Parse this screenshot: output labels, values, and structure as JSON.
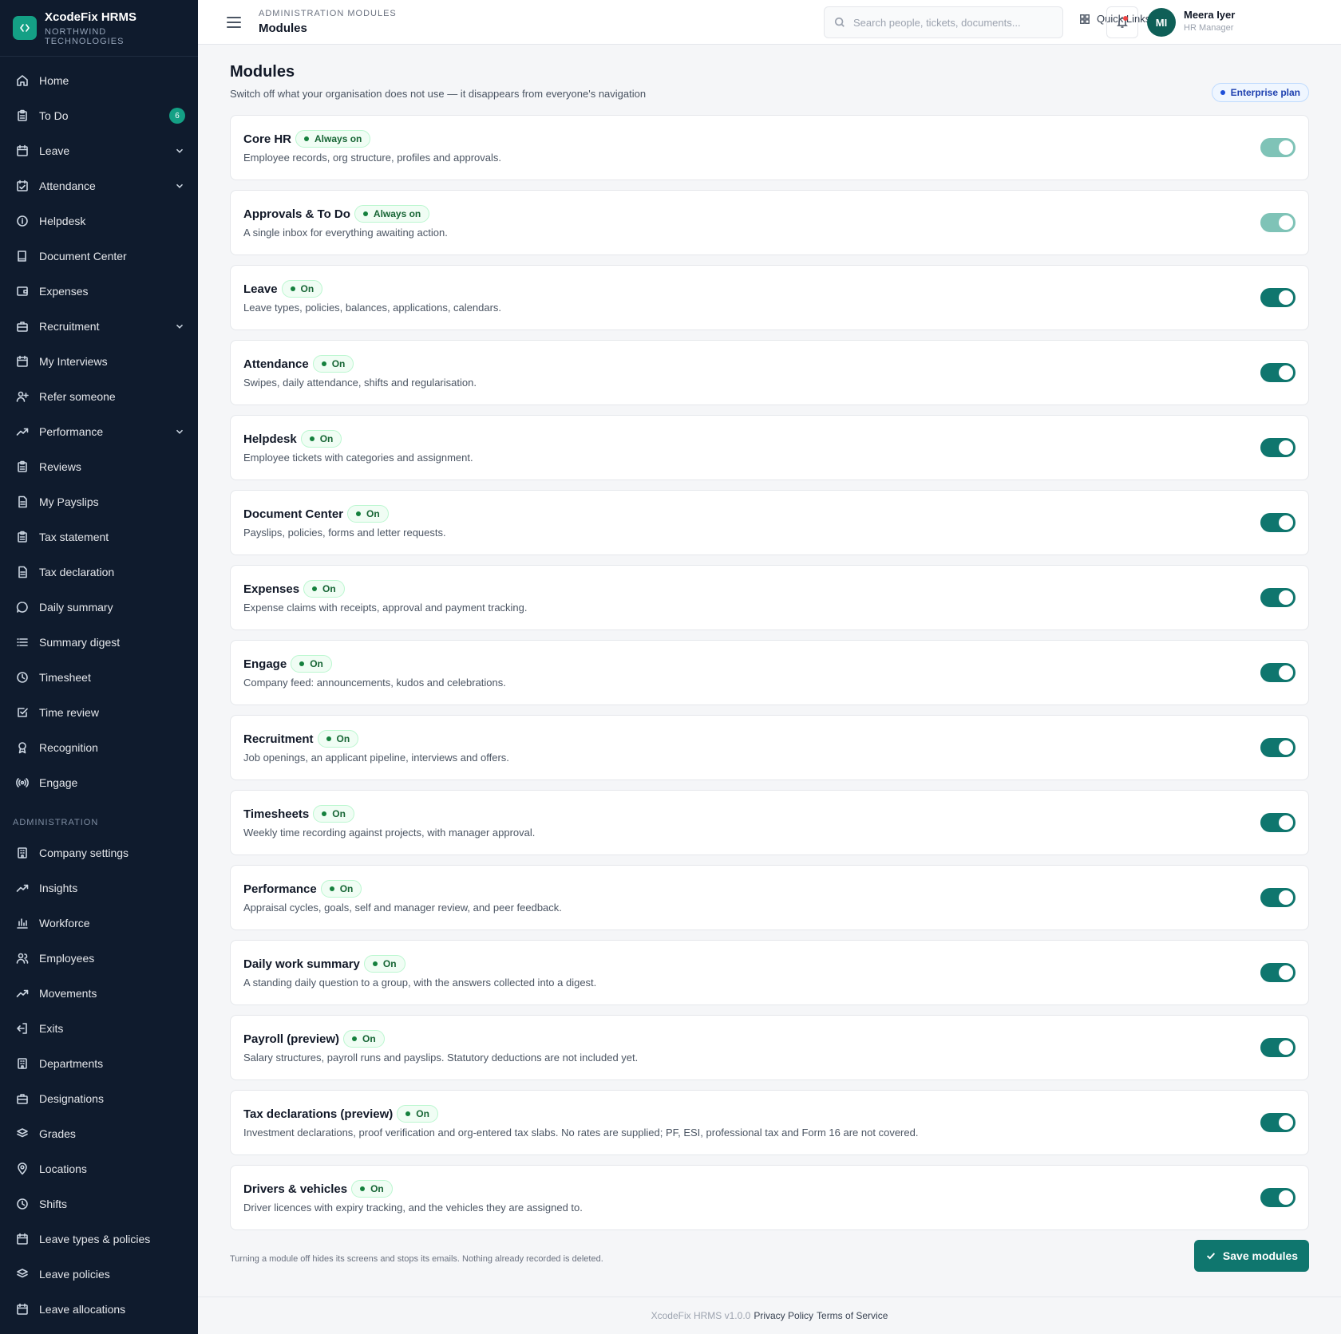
{
  "brand": {
    "name": "XcodeFix HRMS",
    "org": "NORTHWIND TECHNOLOGIES"
  },
  "sidebar": {
    "items": [
      {
        "label": "Home",
        "icon": "home-icon"
      },
      {
        "label": "To Do",
        "icon": "clipboard-icon",
        "badge": "6"
      },
      {
        "label": "Leave",
        "icon": "calendar-icon",
        "chevron": true
      },
      {
        "label": "Attendance",
        "icon": "calendar-check-icon",
        "chevron": true
      },
      {
        "label": "Helpdesk",
        "icon": "info-icon"
      },
      {
        "label": "Document Center",
        "icon": "book-icon"
      },
      {
        "label": "Expenses",
        "icon": "wallet-icon"
      },
      {
        "label": "Recruitment",
        "icon": "briefcase-icon",
        "chevron": true
      },
      {
        "label": "My Interviews",
        "icon": "calendar-icon"
      },
      {
        "label": "Refer someone",
        "icon": "user-plus-icon"
      },
      {
        "label": "Performance",
        "icon": "trend-icon",
        "chevron": true
      },
      {
        "label": "Reviews",
        "icon": "clipboard-icon"
      },
      {
        "label": "My Payslips",
        "icon": "file-icon"
      },
      {
        "label": "Tax statement",
        "icon": "clipboard-icon"
      },
      {
        "label": "Tax declaration",
        "icon": "file-icon"
      },
      {
        "label": "Daily summary",
        "icon": "chat-icon"
      },
      {
        "label": "Summary digest",
        "icon": "list-icon"
      },
      {
        "label": "Timesheet",
        "icon": "clock-icon"
      },
      {
        "label": "Time review",
        "icon": "check-square-icon"
      },
      {
        "label": "Recognition",
        "icon": "award-icon"
      },
      {
        "label": "Engage",
        "icon": "broadcast-icon"
      }
    ],
    "admin_section": "ADMINISTRATION",
    "admin_items": [
      {
        "label": "Company settings",
        "icon": "building-icon"
      },
      {
        "label": "Insights",
        "icon": "trend-icon"
      },
      {
        "label": "Workforce",
        "icon": "bar-chart-icon"
      },
      {
        "label": "Employees",
        "icon": "users-icon"
      },
      {
        "label": "Movements",
        "icon": "trend-icon"
      },
      {
        "label": "Exits",
        "icon": "logout-icon"
      },
      {
        "label": "Departments",
        "icon": "building-icon"
      },
      {
        "label": "Designations",
        "icon": "briefcase-icon"
      },
      {
        "label": "Grades",
        "icon": "layers-icon"
      },
      {
        "label": "Locations",
        "icon": "pin-icon"
      },
      {
        "label": "Shifts",
        "icon": "clock-icon"
      },
      {
        "label": "Leave types & policies",
        "icon": "calendar-icon"
      },
      {
        "label": "Leave policies",
        "icon": "layers-icon"
      },
      {
        "label": "Leave allocations",
        "icon": "calendar-icon"
      }
    ]
  },
  "header": {
    "crumb": "ADMINISTRATION MODULES",
    "title": "Modules",
    "search_placeholder": "Search people, tickets, documents...",
    "quick_links": "Quick Links",
    "user": {
      "initials": "MI",
      "name": "Meera Iyer",
      "role": "HR Manager"
    }
  },
  "page": {
    "title": "Modules",
    "subtitle": "Switch off what your organisation does not use — it disappears from everyone's navigation",
    "plan": "Enterprise plan"
  },
  "modules": [
    {
      "name": "Core HR",
      "status": "Always on",
      "locked": true,
      "enabled": true,
      "description": "Employee records, org structure, profiles and approvals."
    },
    {
      "name": "Approvals & To Do",
      "status": "Always on",
      "locked": true,
      "enabled": true,
      "description": "A single inbox for everything awaiting action."
    },
    {
      "name": "Leave",
      "status": "On",
      "locked": false,
      "enabled": true,
      "description": "Leave types, policies, balances, applications, calendars."
    },
    {
      "name": "Attendance",
      "status": "On",
      "locked": false,
      "enabled": true,
      "description": "Swipes, daily attendance, shifts and regularisation."
    },
    {
      "name": "Helpdesk",
      "status": "On",
      "locked": false,
      "enabled": true,
      "description": "Employee tickets with categories and assignment."
    },
    {
      "name": "Document Center",
      "status": "On",
      "locked": false,
      "enabled": true,
      "description": "Payslips, policies, forms and letter requests."
    },
    {
      "name": "Expenses",
      "status": "On",
      "locked": false,
      "enabled": true,
      "description": "Expense claims with receipts, approval and payment tracking."
    },
    {
      "name": "Engage",
      "status": "On",
      "locked": false,
      "enabled": true,
      "description": "Company feed: announcements, kudos and celebrations."
    },
    {
      "name": "Recruitment",
      "status": "On",
      "locked": false,
      "enabled": true,
      "description": "Job openings, an applicant pipeline, interviews and offers."
    },
    {
      "name": "Timesheets",
      "status": "On",
      "locked": false,
      "enabled": true,
      "description": "Weekly time recording against projects, with manager approval."
    },
    {
      "name": "Performance",
      "status": "On",
      "locked": false,
      "enabled": true,
      "description": "Appraisal cycles, goals, self and manager review, and peer feedback."
    },
    {
      "name": "Daily work summary",
      "status": "On",
      "locked": false,
      "enabled": true,
      "description": "A standing daily question to a group, with the answers collected into a digest."
    },
    {
      "name": "Payroll (preview)",
      "status": "On",
      "locked": false,
      "enabled": true,
      "description": "Salary structures, payroll runs and payslips. Statutory deductions are not included yet."
    },
    {
      "name": "Tax declarations (preview)",
      "status": "On",
      "locked": false,
      "enabled": true,
      "description": "Investment declarations, proof verification and org-entered tax slabs. No rates are supplied; PF, ESI, professional tax and Form 16 are not covered."
    },
    {
      "name": "Drivers & vehicles",
      "status": "On",
      "locked": false,
      "enabled": true,
      "description": "Driver licences with expiry tracking, and the vehicles they are assigned to."
    }
  ],
  "footer_note": "Turning a module off hides its screens and stops its emails. Nothing already recorded is deleted.",
  "save_label": "Save modules",
  "app_footer": {
    "version": "XcodeFix HRMS v1.0.0",
    "privacy": "Privacy Policy",
    "terms": "Terms of Service"
  },
  "colors": {
    "sidebar": "#0f1b2d",
    "accent": "#0f766e",
    "badge": "#14a085",
    "on_pill": "#166534",
    "plan": "#1e40af"
  }
}
